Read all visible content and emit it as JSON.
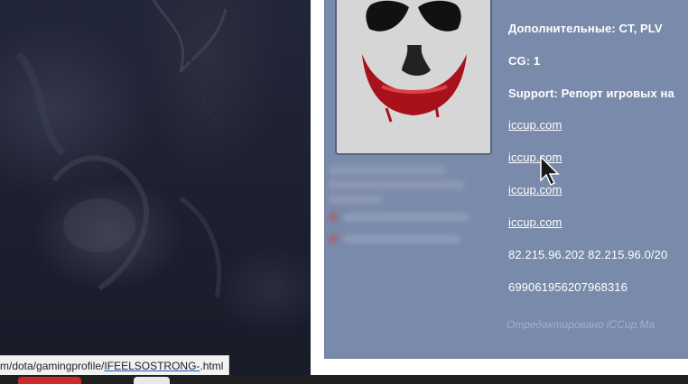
{
  "profile": {
    "additional": "Дополнительные: CT, PLV",
    "cg": "CG: 1",
    "support": "Support: Репорт игровых на",
    "links": [
      "iccup.com",
      "iccup.com",
      "iccup.com",
      "iccup.com"
    ],
    "ips": "82.215.96.202 82.215.96.0/20",
    "id_number": "699061956207968316",
    "edited_note": "Отредактировано iCCup.Ma"
  },
  "status_bar": {
    "url_prefix": "m/dota/gamingprofile/",
    "url_highlight": "IFEELSOSTRONG-",
    "url_suffix": ".html"
  },
  "colors": {
    "panel": "#7a8aaa",
    "text": "#ffffff",
    "edited": "#a3b0c8",
    "link_underline": "#1a5ad0"
  },
  "icons": {
    "avatar": "joker-face-avatar",
    "cursor": "mouse-pointer-icon"
  }
}
